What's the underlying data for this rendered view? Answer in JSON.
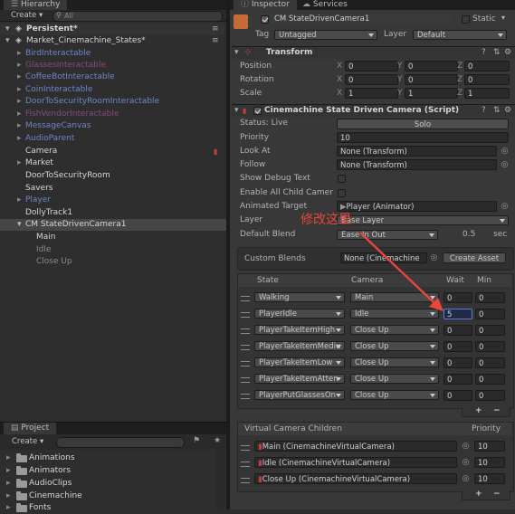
{
  "hierarchy": {
    "tab_label": "Hierarchy",
    "create_label": "Create",
    "search_placeholder": "All",
    "scenes": [
      {
        "name": "Persistent*"
      },
      {
        "name": "Market_Cinemachine_States*"
      }
    ],
    "items": [
      {
        "label": "BirdInteractable",
        "style": "blue"
      },
      {
        "label": "GlassesInteractable",
        "style": "blue"
      },
      {
        "label": "CoffeeBotInteractable",
        "style": "blue"
      },
      {
        "label": "CoinInteractable",
        "style": "blue"
      },
      {
        "label": "DoorToSecurityRoomInteractable",
        "style": "blue"
      },
      {
        "label": "FishVendorInteractable",
        "style": "blue"
      },
      {
        "label": "MessageCanvas",
        "style": "blue"
      },
      {
        "label": "AudioParent",
        "style": "blue"
      },
      {
        "label": "Camera",
        "style": "white"
      },
      {
        "label": "Market",
        "style": "white"
      },
      {
        "label": "DoorToSecurityRoom",
        "style": "white"
      },
      {
        "label": "Savers",
        "style": "white"
      },
      {
        "label": "Player",
        "style": "blue"
      },
      {
        "label": "DollyTrack1",
        "style": "white"
      },
      {
        "label": "CM StateDrivenCamera1",
        "style": "white"
      },
      {
        "label": "Main",
        "style": "white"
      },
      {
        "label": "Idle",
        "style": "dim"
      },
      {
        "label": "Close Up",
        "style": "dim"
      }
    ]
  },
  "project": {
    "tab_label": "Project",
    "create_label": "Create",
    "folders": [
      "Animations",
      "Animators",
      "AudioClips",
      "Cinemachine",
      "Fonts"
    ]
  },
  "inspector": {
    "tab_label": "Inspector",
    "tab2_label": "Services",
    "object_name": "CM StateDrivenCamera1",
    "static_label": "Static",
    "tag_label": "Tag",
    "tag_value": "Untagged",
    "layer_label": "Layer",
    "layer_value": "Default",
    "transform": {
      "title": "Transform",
      "rows": [
        {
          "label": "Position",
          "x": "0",
          "y": "0",
          "z": "0"
        },
        {
          "label": "Rotation",
          "x": "0",
          "y": "0",
          "z": "0"
        },
        {
          "label": "Scale",
          "x": "1",
          "y": "1",
          "z": "1"
        }
      ]
    },
    "sdc": {
      "title": "Cinemachine State Driven Camera (Script)",
      "status_label": "Status: Live",
      "solo_label": "Solo",
      "priority_label": "Priority",
      "priority_value": "10",
      "lookat_label": "Look At",
      "lookat_value": "None (Transform)",
      "follow_label": "Follow",
      "follow_value": "None (Transform)",
      "debug_label": "Show Debug Text",
      "children_label": "Enable All Child Camer",
      "animated_label": "Animated Target",
      "animated_value": "Player (Animator)",
      "layer_label": "Layer",
      "layer_value": "Base Layer",
      "blend_label": "Default Blend",
      "blend_value": "Ease In Out",
      "blend_time": "0.5",
      "blend_unit": "sec",
      "custom_blends_label": "Custom Blends",
      "custom_blends_value": "None (Cinemachine",
      "create_asset_label": "Create Asset",
      "annotation": "修改这里",
      "table_headers": {
        "state": "State",
        "camera": "Camera",
        "wait": "Wait",
        "min": "Min"
      },
      "instructions": [
        {
          "state": "Walking",
          "camera": "Main",
          "wait": "0",
          "min": "0"
        },
        {
          "state": "PlayerIdle",
          "camera": "Idle",
          "wait": "5",
          "min": "0"
        },
        {
          "state": "PlayerTakeItemHigh",
          "camera": "Close Up",
          "wait": "0",
          "min": "0"
        },
        {
          "state": "PlayerTakeItemMediu",
          "camera": "Close Up",
          "wait": "0",
          "min": "0"
        },
        {
          "state": "PlayerTakeItemLow",
          "camera": "Close Up",
          "wait": "0",
          "min": "0"
        },
        {
          "state": "PlayerTakeItemAtten",
          "camera": "Close Up",
          "wait": "0",
          "min": "0"
        },
        {
          "state": "PlayerPutGlassesOn",
          "camera": "Close Up",
          "wait": "0",
          "min": "0"
        }
      ],
      "children_header": "Virtual Camera Children",
      "children_priority_header": "Priority",
      "children": [
        {
          "name": "Main (CinemachineVirtualCamera)",
          "priority": "10"
        },
        {
          "name": "Idle (CinemachineVirtualCamera)",
          "priority": "10"
        },
        {
          "name": "Close Up (CinemachineVirtualCamera)",
          "priority": "10"
        }
      ],
      "plus_label": "+",
      "minus_label": "−"
    }
  },
  "colors": {
    "annotation_red": "#e8453c",
    "accent_blue": "#6d86c8"
  }
}
